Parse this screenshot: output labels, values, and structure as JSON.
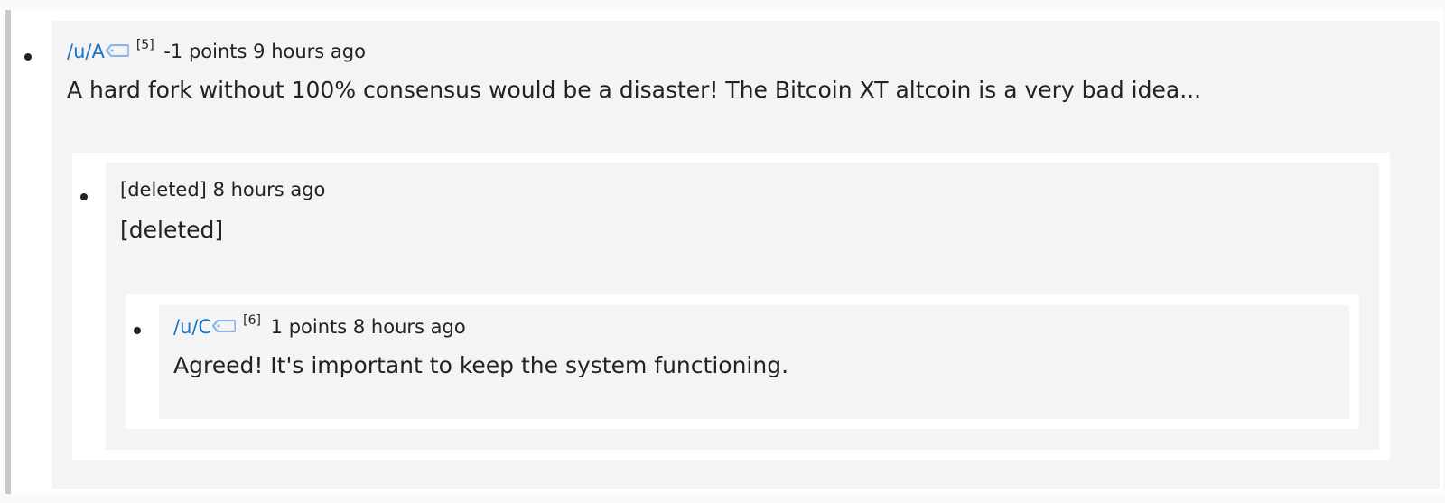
{
  "comments": [
    {
      "user": "/u/A",
      "flair_icon": "tag-icon",
      "ref": "[5]",
      "points": "-1 points",
      "time": "9 hours ago",
      "text": "A hard fork without 100% consensus would be a disaster! The Bitcoin XT altcoin is a very bad idea..."
    },
    {
      "author": "[deleted]",
      "time": "8 hours ago",
      "text": "[deleted]"
    },
    {
      "user": "/u/C",
      "flair_icon": "tag-icon",
      "ref": "[6]",
      "points": "1 points",
      "time": "8 hours ago",
      "text": "Agreed! It's important to keep the system functioning."
    }
  ],
  "colors": {
    "username": "#1a73c8",
    "comment_bg": "#f4f4f4",
    "thread_bar": "#c8c8c8",
    "tag_icon": "#8fb6e0"
  }
}
